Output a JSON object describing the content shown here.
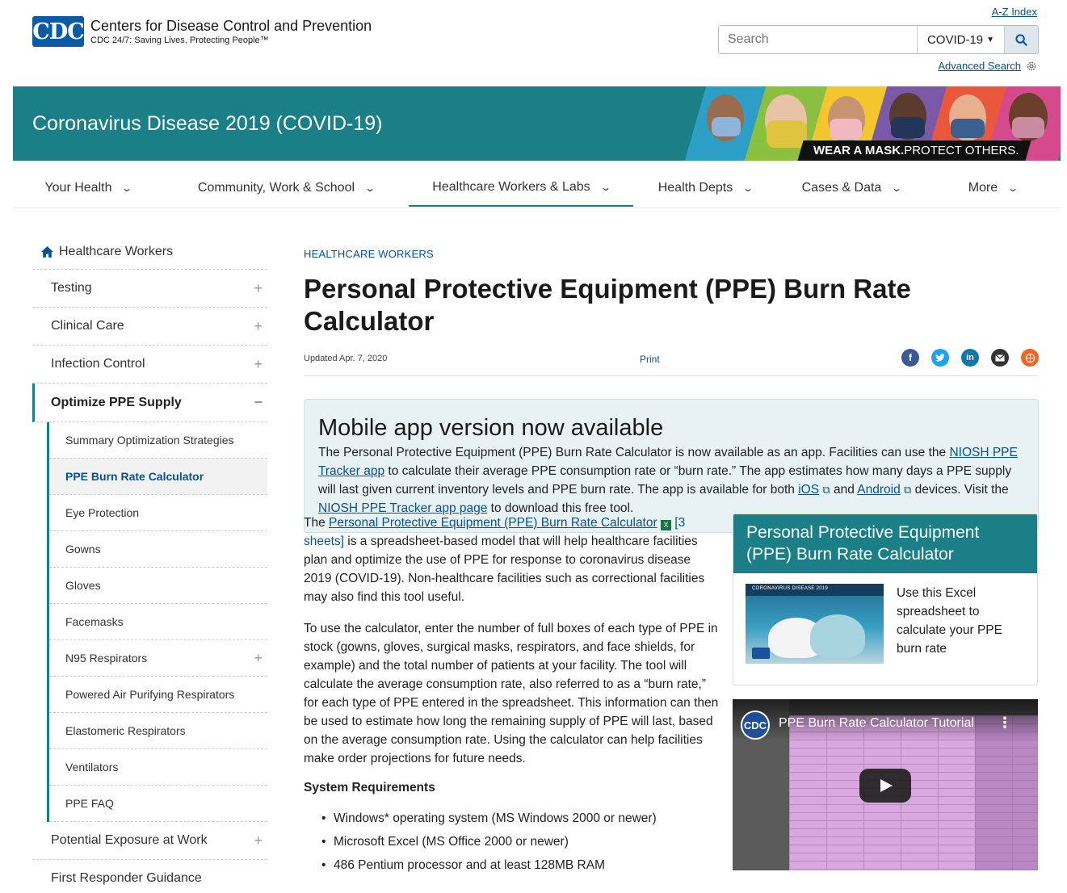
{
  "header": {
    "logo_mark": "CDC",
    "org_name": "Centers for Disease Control and Prevention",
    "tagline": "CDC 24/7: Saving Lives, Protecting People™",
    "az_index": "A-Z Index",
    "search_placeholder": "Search",
    "search_scope": "COVID-19",
    "advanced_search": "Advanced Search"
  },
  "banner": {
    "title": "Coronavirus Disease 2019 (COVID-19)",
    "tag_bold": "WEAR A MASK.",
    "tag_rest": " PROTECT OTHERS."
  },
  "topnav": [
    {
      "label": "Your Health",
      "width": 186
    },
    {
      "label": "Community, Work & School",
      "width": 304
    },
    {
      "label": "Healthcare Workers & Labs",
      "width": 278,
      "active": true
    },
    {
      "label": "Health Depts",
      "width": 178
    },
    {
      "label": "Cases & Data",
      "width": 184
    },
    {
      "label": "More",
      "width": 166
    }
  ],
  "sidebar": {
    "home": "Healthcare Workers",
    "items": [
      "Testing",
      "Clinical Care",
      "Infection Control"
    ],
    "open_item": "Optimize PPE Supply",
    "sub_items": [
      {
        "label": "Summary Optimization Strategies"
      },
      {
        "label": "PPE Burn Rate Calculator",
        "active": true
      },
      {
        "label": "Eye Protection"
      },
      {
        "label": "Gowns"
      },
      {
        "label": "Gloves"
      },
      {
        "label": "Facemasks"
      },
      {
        "label": "N95 Respirators",
        "expandable": true
      },
      {
        "label": "Powered Air Purifying Respirators"
      },
      {
        "label": "Elastomeric Respirators"
      },
      {
        "label": "Ventilators"
      },
      {
        "label": "PPE FAQ"
      }
    ],
    "after_items": [
      "Potential Exposure at Work",
      "First Responder Guidance"
    ]
  },
  "main": {
    "eyebrow": "HEALTHCARE WORKERS",
    "title": "Personal Protective Equipment (PPE) Burn Rate Calculator",
    "updated": "Updated Apr. 7, 2020",
    "print": "Print",
    "callout": {
      "heading": "Mobile app version now available",
      "t1": "The Personal Protective Equipment (PPE) Burn Rate Calculator is now available as an app. Facilities can use the ",
      "link1": "NIOSH PPE Tracker app",
      "t2": " to calculate their average PPE consumption rate or “burn rate.” The app estimates how many days a PPE supply will last given current inventory levels and PPE burn rate. The app is available for both ",
      "link_ios": "iOS",
      "t3": " and ",
      "link_android": "Android",
      "t4": " devices. Visit the ",
      "link2": "NIOSH PPE Tracker app page",
      "t5": " to download this free tool."
    },
    "para1": {
      "t1": "The ",
      "link": "Personal Protective Equipment (PPE) Burn Rate Calculator",
      "link2": "[3 sheets]",
      "t2": " is a spreadsheet-based model that will help healthcare facilities plan and optimize the use of PPE for response to coronavirus disease 2019 (COVID-19). Non-healthcare facilities such as correctional facilities may also find this tool useful."
    },
    "para2": "To use the calculator, enter the number of full boxes of each type of PPE in stock (gowns, gloves, surgical masks, respirators, and face shields, for example) and the total number of patients at your facility. The tool will calculate the average consumption rate, also referred to as a “burn rate,” for each type of PPE entered in the spreadsheet. This information can then be used to estimate how long the remaining supply of PPE will last, based on the average consumption rate. Using the calculator can help facilities make order projections for future needs.",
    "sysreq_title": "System Requirements",
    "sysreq": [
      "Windows* operating system (MS Windows 2000 or newer)",
      "Microsoft Excel (MS Office 2000 or newer)",
      "486 Pentium processor and at least 128MB RAM"
    ],
    "card": {
      "title": "Personal Protective Equipment (PPE) Burn Rate Calculator",
      "img_label": "CORONAVIRUS DISEASE 2019",
      "text": "Use this Excel spreadsheet to calculate your PPE burn rate"
    },
    "video": {
      "logo": "CDC",
      "title": "PPE Burn Rate Calculator Tutorial"
    }
  },
  "colors": {
    "teal": "#1a7f86",
    "link": "#075290",
    "facebook": "#3b5998",
    "twitter": "#1da1f2",
    "linkedin": "#0e76a8",
    "email": "#333333",
    "syndicate": "#f26522"
  }
}
